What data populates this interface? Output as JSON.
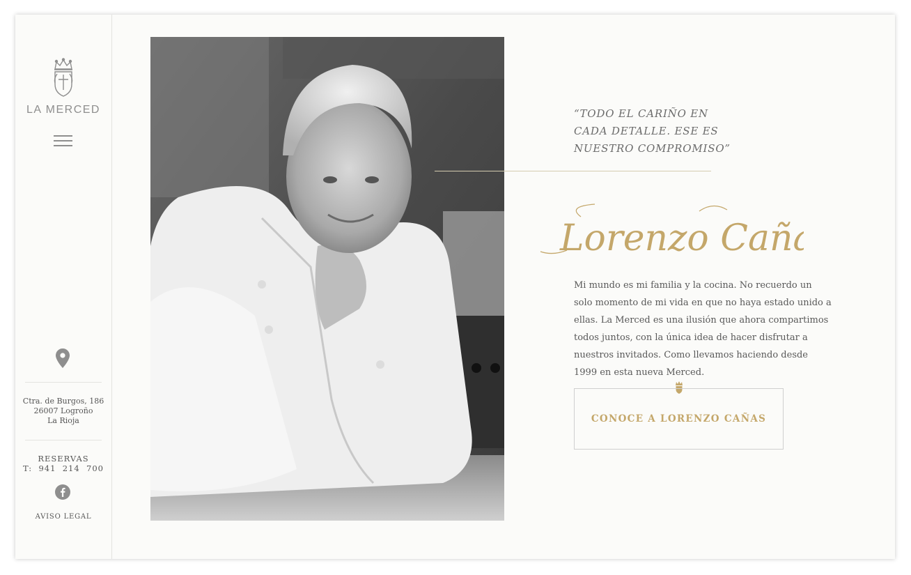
{
  "brand": {
    "name": "LA MERCED",
    "logo_icon": "crest-crown-shield-icon"
  },
  "sidebar": {
    "menu_icon": "hamburger-menu-icon",
    "location_icon": "map-pin-icon",
    "address": {
      "line1": "Ctra. de Burgos, 186",
      "line2": "26007 Logroño",
      "line3": "La Rioja"
    },
    "reservations": {
      "label": "RESERVAS",
      "phone": "T:  941  214  700"
    },
    "social_icon": "facebook-icon",
    "legal_link": "AVISO LEGAL"
  },
  "main": {
    "photo_alt": "Lorenzo Cañas",
    "quote": {
      "line1": "“TODO EL CARIÑO EN",
      "line2": "CADA DETALLE. ESE ES",
      "line3": "NUESTRO COMPROMISO”"
    },
    "signature": "Lorenzo Cañas",
    "bio": "Mi mundo es mi familia y la cocina. No recuerdo un solo momento de mi vida en que no haya estado unido a ellas. La Merced es una ilusión que ahora compartimos todos juntos, con la única idea de hacer disfrutar a nuestros invitados. Como llevamos haciendo desde 1999 en esta nueva Merced.",
    "cta_label": "CONOCE A LORENZO CAÑAS"
  },
  "colors": {
    "gold": "#c4a76a",
    "grey": "#8e8e8e",
    "background": "#fbfbf9"
  }
}
